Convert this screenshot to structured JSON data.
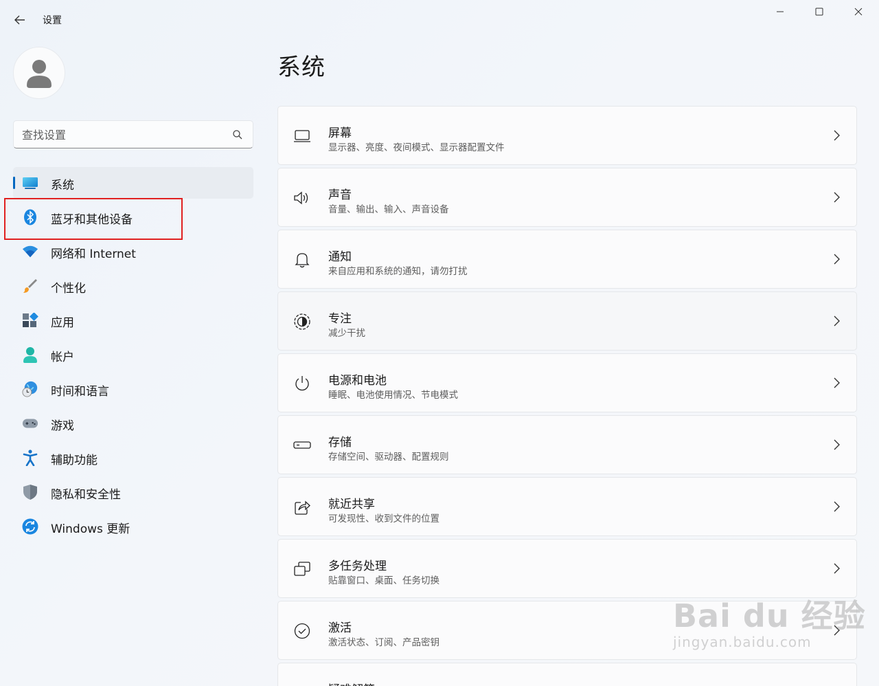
{
  "window": {
    "title": "设置"
  },
  "search": {
    "placeholder": "查找设置"
  },
  "sidebar": {
    "items": [
      {
        "label": "系统",
        "icon": "system-monitor-icon",
        "active": true
      },
      {
        "label": "蓝牙和其他设备",
        "icon": "bluetooth-icon"
      },
      {
        "label": "网络和 Internet",
        "icon": "wifi-icon"
      },
      {
        "label": "个性化",
        "icon": "paintbrush-icon"
      },
      {
        "label": "应用",
        "icon": "apps-icon"
      },
      {
        "label": "帐户",
        "icon": "account-icon"
      },
      {
        "label": "时间和语言",
        "icon": "globe-clock-icon"
      },
      {
        "label": "游戏",
        "icon": "gamepad-icon"
      },
      {
        "label": "辅助功能",
        "icon": "accessibility-icon"
      },
      {
        "label": "隐私和安全性",
        "icon": "shield-icon"
      },
      {
        "label": "Windows 更新",
        "icon": "update-icon"
      }
    ]
  },
  "main": {
    "title": "系统",
    "cards": [
      {
        "title": "屏幕",
        "subtitle": "显示器、亮度、夜间模式、显示器配置文件",
        "icon": "display-icon"
      },
      {
        "title": "声音",
        "subtitle": "音量、输出、输入、声音设备",
        "icon": "speaker-icon"
      },
      {
        "title": "通知",
        "subtitle": "来自应用和系统的通知，请勿打扰",
        "icon": "bell-icon"
      },
      {
        "title": "专注",
        "subtitle": "减少干扰",
        "icon": "focus-icon"
      },
      {
        "title": "电源和电池",
        "subtitle": "睡眠、电池使用情况、节电模式",
        "icon": "power-icon"
      },
      {
        "title": "存储",
        "subtitle": "存储空间、驱动器、配置规则",
        "icon": "storage-icon"
      },
      {
        "title": "就近共享",
        "subtitle": "可发现性、收到文件的位置",
        "icon": "share-icon"
      },
      {
        "title": "多任务处理",
        "subtitle": "贴靠窗口、桌面、任务切换",
        "icon": "multitask-icon"
      },
      {
        "title": "激活",
        "subtitle": "激活状态、订阅、产品密钥",
        "icon": "activation-icon"
      },
      {
        "title": "疑难解答",
        "subtitle": "",
        "icon": "troubleshoot-icon"
      }
    ]
  },
  "watermark": {
    "brand": "Bai du 经验",
    "url": "jingyan.baidu.com"
  },
  "colors": {
    "accent": "#0067c0",
    "highlight": "#e02020"
  }
}
